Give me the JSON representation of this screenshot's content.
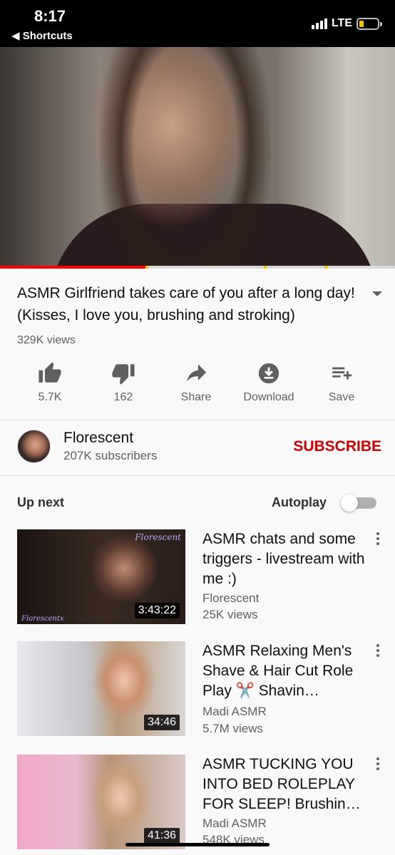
{
  "status_bar": {
    "time": "8:17",
    "back_label": "◀ Shortcuts",
    "network": "LTE"
  },
  "video": {
    "title": "ASMR Girlfriend takes care of you after a long day! (Kisses, I love you, brushing and stroking)",
    "views": "329K views",
    "progress_fraction": 0.37,
    "colors": {
      "played": "#ff0000",
      "marker": "#f2c200"
    }
  },
  "actions": {
    "like": {
      "label": "5.7K",
      "icon": "thumbs-up-icon"
    },
    "dislike": {
      "label": "162",
      "icon": "thumbs-down-icon"
    },
    "share": {
      "label": "Share",
      "icon": "share-icon"
    },
    "download": {
      "label": "Download",
      "icon": "download-icon"
    },
    "save": {
      "label": "Save",
      "icon": "playlist-add-icon"
    }
  },
  "channel": {
    "name": "Florescent",
    "subscribers": "207K subscribers",
    "subscribe_label": "SUBSCRIBE",
    "subscribe_color": "#cc0000"
  },
  "up_next": {
    "label": "Up next",
    "autoplay_label": "Autoplay",
    "autoplay_on": false
  },
  "videos": [
    {
      "title": "ASMR chats and some triggers - livestream with me :)",
      "channel": "Florescent",
      "views": "25K views",
      "duration": "3:43:22",
      "watermark_top": "Florescent",
      "watermark_bottom": "Florescentx"
    },
    {
      "title": "ASMR Relaxing Men's Shave & Hair Cut Role Play ✂️ Shavin…",
      "channel": "Madi ASMR",
      "views": "5.7M views",
      "duration": "34:46"
    },
    {
      "title": "ASMR TUCKING YOU INTO BED ROLEPLAY FOR SLEEP! Brushin…",
      "channel": "Madi ASMR",
      "views": "548K views",
      "duration": "41:36"
    }
  ]
}
